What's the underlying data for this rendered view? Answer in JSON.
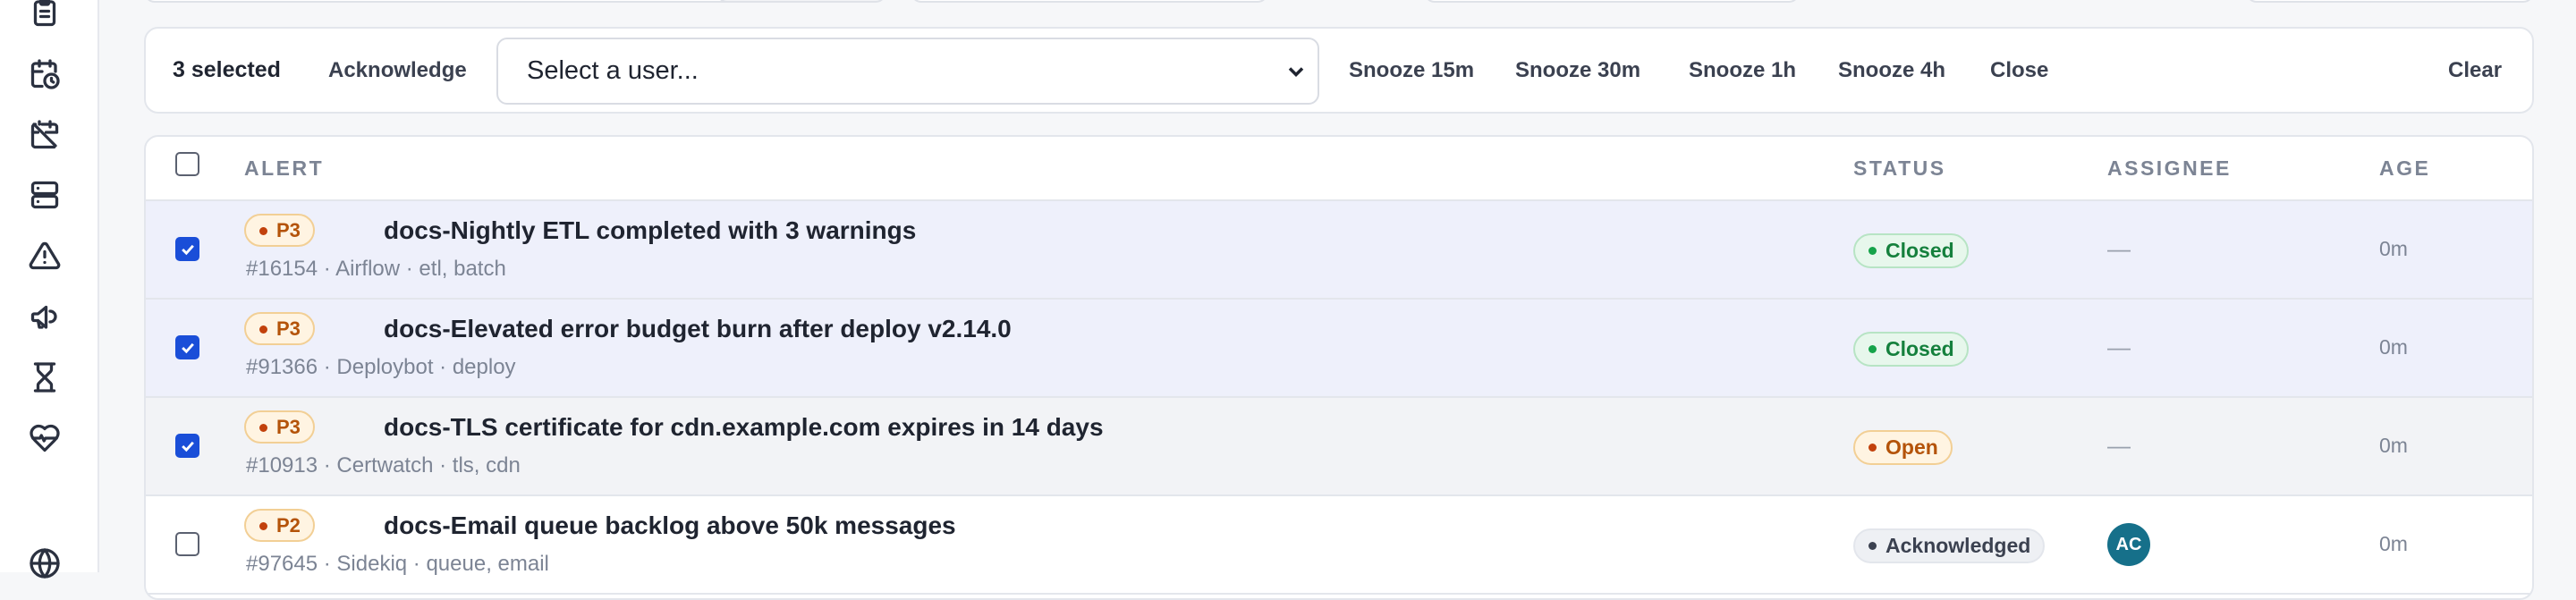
{
  "sidebar": {
    "icons": [
      "clipboard-icon",
      "calendar-clock-icon",
      "calendar-off-icon",
      "server-icon",
      "alert-triangle-icon",
      "megaphone-icon",
      "hourglass-icon",
      "heart-pulse-icon",
      "globe-icon"
    ]
  },
  "bulk": {
    "selected_count": "3 selected",
    "acknowledge": "Acknowledge",
    "user_select": "Select a user...",
    "snooze_15": "Snooze 15m",
    "snooze_30": "Snooze 30m",
    "snooze_1h": "Snooze 1h",
    "snooze_4h": "Snooze 4h",
    "close": "Close",
    "clear": "Clear"
  },
  "table": {
    "headers": {
      "alert": "ALERT",
      "status": "STATUS",
      "assignee": "ASSIGNEE",
      "age": "AGE"
    },
    "rows": [
      {
        "checked": true,
        "priority": "P3",
        "title": "docs-Nightly ETL completed with 3 warnings",
        "meta": "#16154 · Airflow · etl, batch",
        "status": "Closed",
        "assignee": "—",
        "age": "0m"
      },
      {
        "checked": true,
        "priority": "P3",
        "title": "docs-Elevated error budget burn after deploy v2.14.0",
        "meta": "#91366 · Deploybot · deploy",
        "status": "Closed",
        "assignee": "—",
        "age": "0m"
      },
      {
        "checked": true,
        "priority": "P3",
        "title": "docs-TLS certificate for cdn.example.com expires in 14 days",
        "meta": "#10913 · Certwatch · tls, cdn",
        "status": "Open",
        "assignee": "—",
        "age": "0m"
      },
      {
        "checked": false,
        "priority": "P2",
        "title": "docs-Email queue backlog above 50k messages",
        "meta": "#97645 · Sidekiq · queue, email",
        "status": "Acknowledged",
        "assignee": "AC",
        "age": "0m"
      }
    ]
  }
}
